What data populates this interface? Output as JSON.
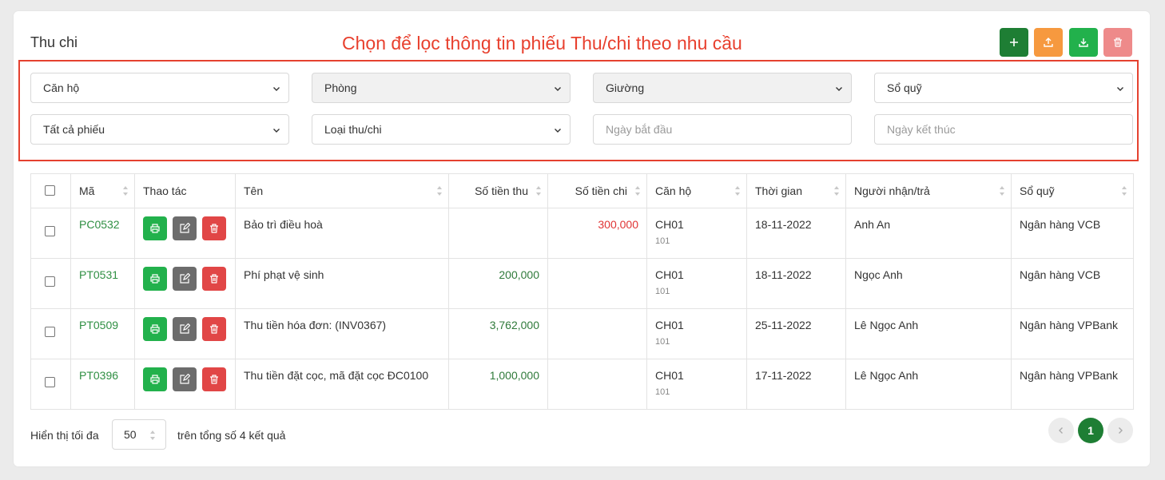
{
  "page": {
    "title": "Thu chi",
    "annotation": "Chọn để lọc thông tin phiếu Thu/chi theo nhu cầu"
  },
  "toolbar": {
    "add": {
      "icon": "plus-icon",
      "color": "#1e7e34"
    },
    "upload": {
      "icon": "upload-icon",
      "color": "#f6993f"
    },
    "download": {
      "icon": "download-icon",
      "color": "#22b14c"
    },
    "delete": {
      "icon": "trash-icon",
      "color": "#ee8a8a"
    }
  },
  "filters": {
    "apartment": "Căn hộ",
    "room": "Phòng",
    "bed": "Giường",
    "fund_book": "Sổ quỹ",
    "all_vouchers": "Tất cả phiếu",
    "type": "Loại thu/chi",
    "start_date_placeholder": "Ngày bắt đầu",
    "end_date_placeholder": "Ngày kết thúc"
  },
  "table": {
    "headers": {
      "code": "Mã",
      "actions": "Thao tác",
      "name": "Tên",
      "amount_in": "Số tiền thu",
      "amount_out": "Số tiền chi",
      "apartment": "Căn hộ",
      "time": "Thời gian",
      "person": "Người nhận/trả",
      "fund_book": "Sổ quỹ"
    },
    "rows": [
      {
        "code": "PC0532",
        "name": "Bảo trì điều hoà",
        "amount_in": "",
        "amount_out": "300,000",
        "apartment": "CH01",
        "room": "101",
        "time": "18-11-2022",
        "person": "Anh An",
        "fund_book": "Ngân hàng VCB"
      },
      {
        "code": "PT0531",
        "name": "Phí phạt vệ sinh",
        "amount_in": "200,000",
        "amount_out": "",
        "apartment": "CH01",
        "room": "101",
        "time": "18-11-2022",
        "person": "Ngọc Anh",
        "fund_book": "Ngân hàng VCB"
      },
      {
        "code": "PT0509",
        "name": "Thu tiền hóa đơn: (INV0367)",
        "amount_in": "3,762,000",
        "amount_out": "",
        "apartment": "CH01",
        "room": "101",
        "time": "25-11-2022",
        "person": "Lê Ngọc Anh",
        "fund_book": "Ngân hàng VPBank"
      },
      {
        "code": "PT0396",
        "name": "Thu tiền đặt cọc, mã đặt cọc ĐC0100",
        "amount_in": "1,000,000",
        "amount_out": "",
        "apartment": "CH01",
        "room": "101",
        "time": "17-11-2022",
        "person": "Lê Ngọc Anh",
        "fund_book": "Ngân hàng VPBank"
      }
    ]
  },
  "footer": {
    "show_label": "Hiển thị tối đa",
    "page_size": "50",
    "total_text": "trên tổng số 4 kết quả",
    "current_page": "1"
  }
}
